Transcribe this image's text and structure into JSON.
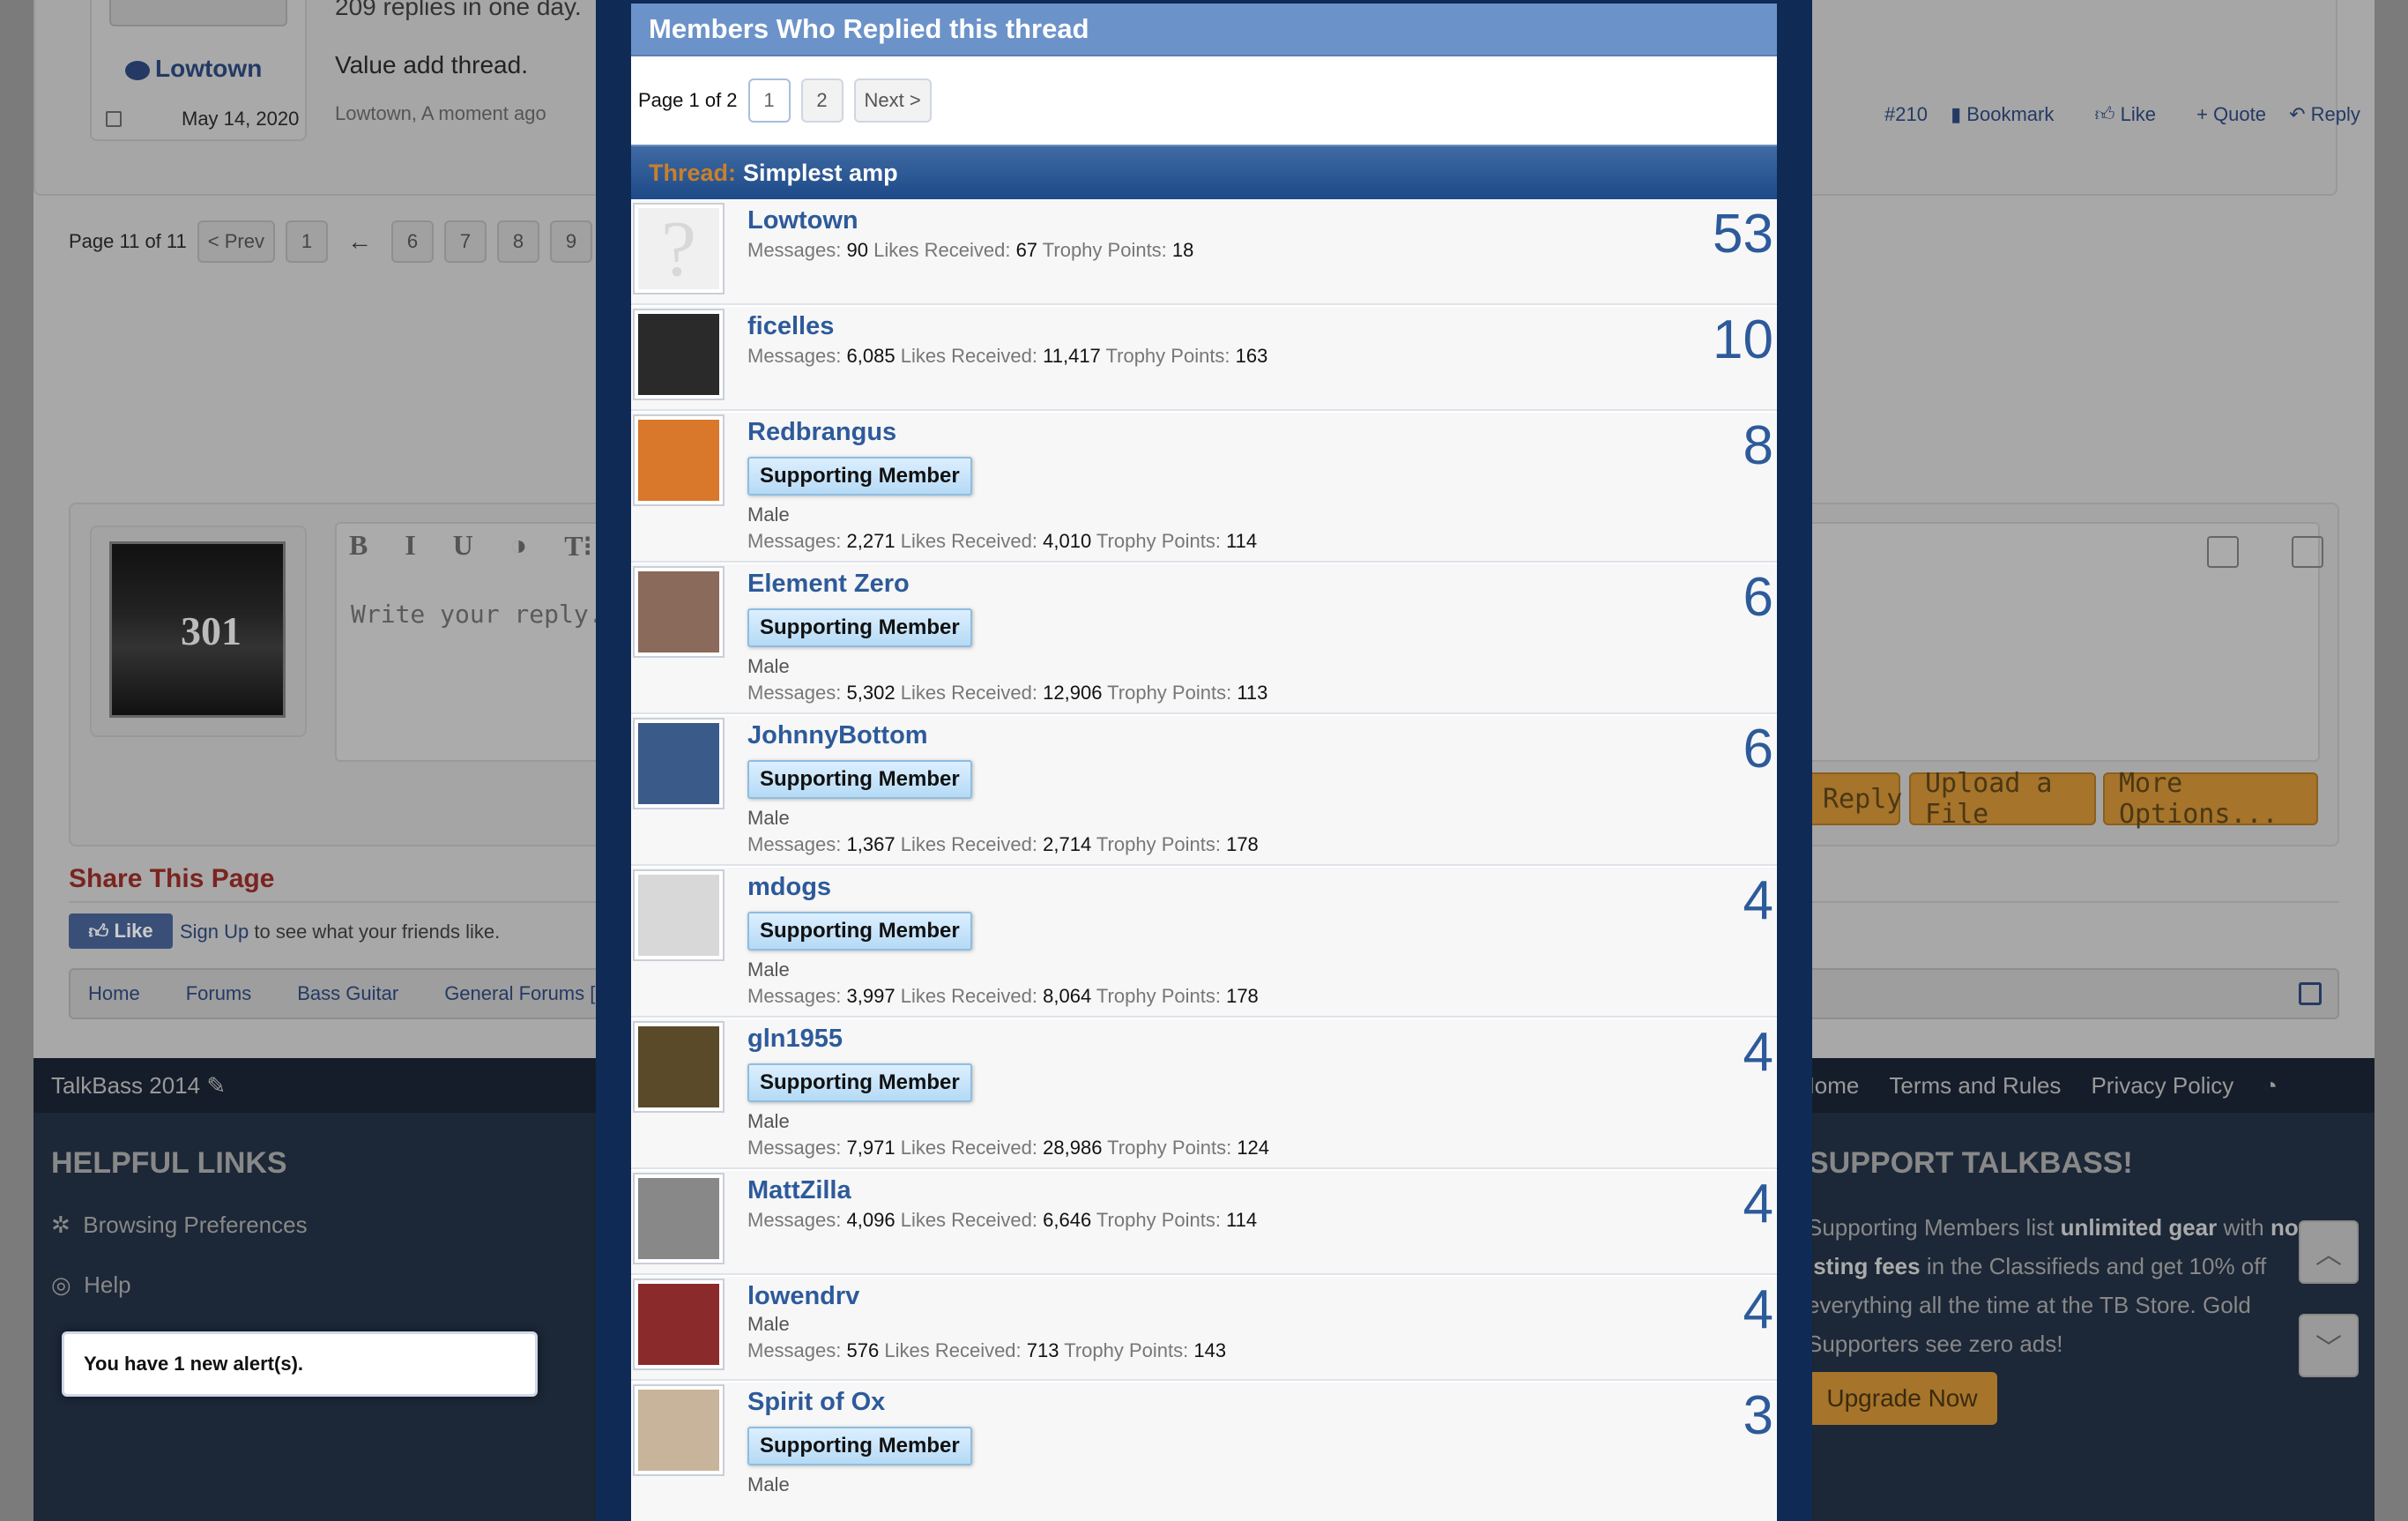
{
  "background": {
    "post": {
      "author": "Lowtown",
      "date": "May 14, 2020",
      "line1": "209 replies in one day.",
      "line2": "Value add thread.",
      "meta": "Lowtown, A moment ago",
      "post_number": "#210",
      "actions": [
        "Bookmark",
        "Like",
        "+ Quote",
        "Reply"
      ]
    },
    "pager": {
      "label": "Page 11 of 11",
      "prev": "< Prev",
      "pages": [
        "1",
        "6",
        "7",
        "8",
        "9"
      ],
      "ellipsis": "←"
    },
    "editor": {
      "toolbar": [
        "B",
        "I",
        "U",
        "◑",
        "T⁝"
      ],
      "placeholder": "Write your reply...",
      "avatar_text": "301",
      "buttons": [
        "Reply",
        "Upload a File",
        "More Options..."
      ]
    },
    "share": {
      "title": "Share This Page",
      "like_label": "Like",
      "signup": "Sign Up",
      "signup_rest": " to see what your friends like."
    },
    "breadcrumbs": [
      "Home",
      "Forums",
      "Bass Guitar",
      "General Forums [B"
    ],
    "footer": {
      "brand": "TalkBass 2014",
      "links": [
        "Home",
        "Terms and Rules",
        "Privacy Policy"
      ],
      "helpful_title": "HELPFUL LINKS",
      "helpful_links": [
        "Browsing Preferences",
        "Help"
      ],
      "support_title": "SUPPORT TALKBASS!",
      "support_text_1": "Supporting Members list ",
      "support_bold_1": "unlimited gear",
      "support_text_2": " with ",
      "support_bold_2": "no",
      "support_bold_3": "isting fees",
      "support_text_3": " in the Classifieds and get 10% off everything all the time at the TB Store. Gold Supporters see zero ads!",
      "upgrade": "Upgrade Now"
    },
    "alert": "You have 1 new alert(s)."
  },
  "modal": {
    "title": "Members Who Replied this thread",
    "page_label": "Page 1 of 2",
    "pages": [
      "1",
      "2"
    ],
    "next": "Next >",
    "thread_label": "Thread:",
    "thread_name": "Simplest amp",
    "stat_labels": {
      "messages": "Messages:",
      "likes": "Likes Received:",
      "trophy": "Trophy Points:"
    },
    "members": [
      {
        "name": "Lowtown",
        "badge": "",
        "gender": "",
        "messages": "90",
        "likes": "67",
        "trophy": "18",
        "count": "53",
        "avatar": "placeholder"
      },
      {
        "name": "ficelles",
        "badge": "",
        "gender": "",
        "messages": "6,085",
        "likes": "11,417",
        "trophy": "163",
        "count": "10",
        "avatar": "#2a2a2a"
      },
      {
        "name": "Redbrangus",
        "badge": "Supporting Member",
        "gender": "Male",
        "messages": "2,271",
        "likes": "4,010",
        "trophy": "114",
        "count": "8",
        "avatar": "#d9782a"
      },
      {
        "name": "Element Zero",
        "badge": "Supporting Member",
        "gender": "Male",
        "messages": "5,302",
        "likes": "12,906",
        "trophy": "113",
        "count": "6",
        "avatar": "#8a6a5a"
      },
      {
        "name": "JohnnyBottom",
        "badge": "Supporting Member",
        "gender": "Male",
        "messages": "1,367",
        "likes": "2,714",
        "trophy": "178",
        "count": "6",
        "avatar": "#3a5a8a"
      },
      {
        "name": "mdogs",
        "badge": "Supporting Member",
        "gender": "Male",
        "messages": "3,997",
        "likes": "8,064",
        "trophy": "178",
        "count": "4",
        "avatar": "#d8d8d8"
      },
      {
        "name": "gln1955",
        "badge": "Supporting Member",
        "gender": "Male",
        "messages": "7,971",
        "likes": "28,986",
        "trophy": "124",
        "count": "4",
        "avatar": "#5a4a2a"
      },
      {
        "name": "MattZilla",
        "badge": "",
        "gender": "",
        "messages": "4,096",
        "likes": "6,646",
        "trophy": "114",
        "count": "4",
        "avatar": "#888888"
      },
      {
        "name": "lowendrv",
        "badge": "",
        "gender": "Male",
        "messages": "576",
        "likes": "713",
        "trophy": "143",
        "count": "4",
        "avatar": "#8a2a2a"
      },
      {
        "name": "Spirit of Ox",
        "badge": "Supporting Member",
        "gender": "Male",
        "messages": "",
        "likes": "",
        "trophy": "",
        "count": "3",
        "avatar": "#c8b49a"
      }
    ]
  },
  "colors": {
    "accent": "#2d5a9a",
    "modal_header": "#6c93c9",
    "thread_bar": "#1d4a88",
    "frame": "#0f2a55",
    "badge": "#b5daf5"
  }
}
